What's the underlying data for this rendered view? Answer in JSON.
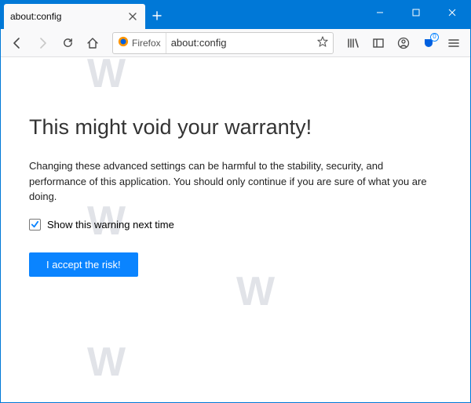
{
  "tab": {
    "title": "about:config"
  },
  "urlbar": {
    "identity_label": "Firefox",
    "url": "about:config"
  },
  "toolbar": {
    "pocket_badge": "0"
  },
  "content": {
    "heading": "This might void your warranty!",
    "warning": "Changing these advanced settings can be harmful to the stability, security, and performance of this application. You should only continue if you are sure of what you are doing.",
    "checkbox_label": "Show this warning next time",
    "accept_label": "I accept the risk!"
  }
}
